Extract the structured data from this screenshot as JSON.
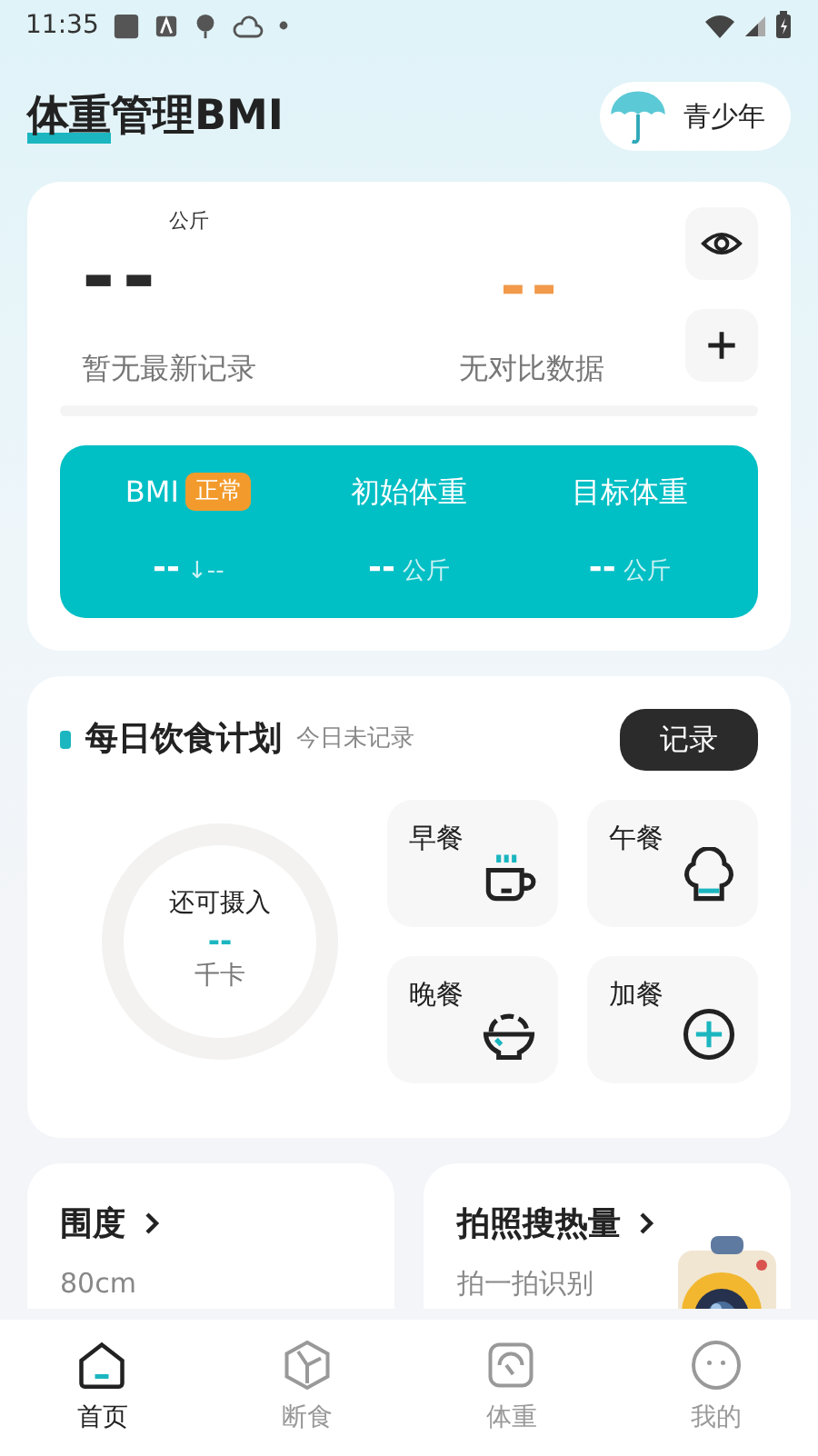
{
  "status_bar": {
    "time": "11:35"
  },
  "header": {
    "title_highlight": "体重",
    "title_rest": "管理BMI",
    "mode_button": "青少年"
  },
  "weight_card": {
    "latest": {
      "value": "--",
      "unit": "公斤",
      "caption": "暂无最新记录"
    },
    "compare": {
      "value": "--",
      "caption": "无对比数据"
    },
    "stats": [
      {
        "label": "BMI",
        "badge": "正常",
        "value": "--",
        "extra": "↓--"
      },
      {
        "label": "初始体重",
        "value": "--",
        "extra": "公斤"
      },
      {
        "label": "目标体重",
        "value": "--",
        "extra": "公斤"
      }
    ]
  },
  "diet": {
    "title": "每日饮食计划",
    "status": "今日未记录",
    "button": "记录",
    "ring": {
      "label": "还可摄入",
      "value": "--",
      "unit": "千卡"
    },
    "meals": [
      {
        "label": "早餐",
        "kind": "cup"
      },
      {
        "label": "午餐",
        "kind": "chef"
      },
      {
        "label": "晚餐",
        "kind": "bowl"
      },
      {
        "label": "加餐",
        "kind": "plus"
      }
    ]
  },
  "tiles": [
    {
      "title": "围度",
      "detail": "80cm"
    },
    {
      "title": "拍照搜热量",
      "detail": "拍一拍识别",
      "kind": "picture"
    }
  ],
  "nav": [
    {
      "label": "首页",
      "kind": "home",
      "selected": true
    },
    {
      "label": "断食",
      "kind": "cube",
      "selected": false
    },
    {
      "label": "体重",
      "kind": "scale",
      "selected": false
    },
    {
      "label": "我的",
      "kind": "face",
      "selected": false
    }
  ]
}
